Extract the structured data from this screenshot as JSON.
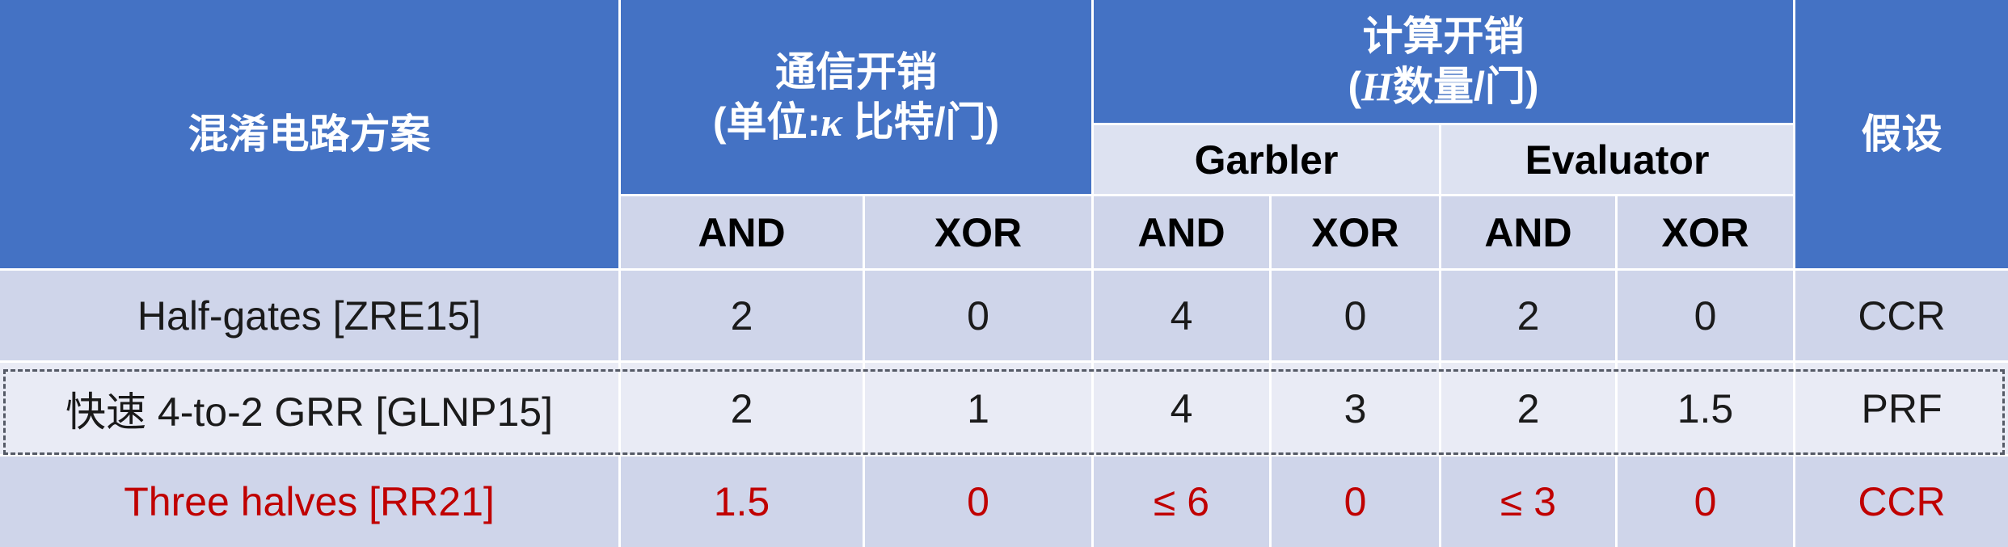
{
  "header": {
    "scheme": "混淆电路方案",
    "comm_title": "通信开销",
    "comm_unit_prefix": "(单位:",
    "comm_unit_symbol": "κ",
    "comm_unit_suffix": " 比特/门)",
    "comp_title": "计算开销",
    "comp_unit_symbol": "H",
    "comp_unit_suffix": "数量/门)",
    "comp_unit_prefix": "(",
    "assumption": "假设",
    "garbler": "Garbler",
    "evaluator": "Evaluator",
    "and": "AND",
    "xor": "XOR"
  },
  "rows": [
    {
      "scheme": "Half-gates [ZRE15]",
      "comm_and": "2",
      "comm_xor": "0",
      "garb_and": "4",
      "garb_xor": "0",
      "eval_and": "2",
      "eval_xor": "0",
      "assumption": "CCR"
    },
    {
      "scheme": "快速 4-to-2 GRR [GLNP15]",
      "comm_and": "2",
      "comm_xor": "1",
      "garb_and": "4",
      "garb_xor": "3",
      "eval_and": "2",
      "eval_xor": "1.5",
      "assumption": "PRF"
    },
    {
      "scheme": "Three halves [RR21]",
      "comm_and": "1.5",
      "comm_xor": "0",
      "garb_and": "≤ 6",
      "garb_xor": "0",
      "eval_and": "≤ 3",
      "eval_xor": "0",
      "assumption": "CCR"
    }
  ],
  "colors": {
    "header_bg": "#4472c4",
    "subheader_bg": "#cfd5ea",
    "row_alt_bg": "#e9ebf5",
    "highlight_text": "#c00000"
  }
}
